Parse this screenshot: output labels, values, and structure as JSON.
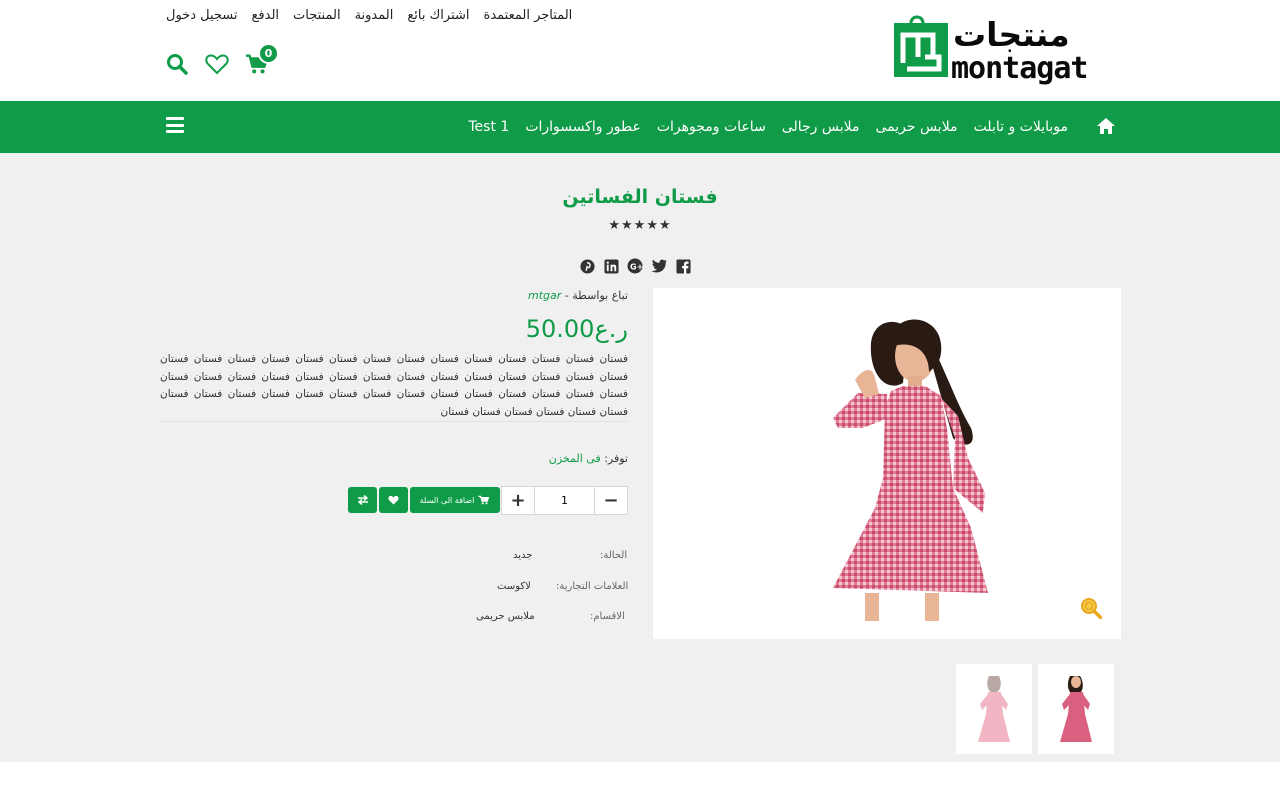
{
  "header": {
    "top_links": [
      "المتاجر المعتمدة",
      "اشتراك بائع",
      "المدونة",
      "المنتجات",
      "الدفع",
      "تسجيل دخول"
    ],
    "cart_count": "0",
    "logo": {
      "text_ar": "منتجات",
      "text_en": "montagat",
      "icon": "shopping-bag-logo"
    }
  },
  "nav": {
    "items": [
      "موبايلات و تابلت",
      "ملابس حريمى",
      "ملابس رجالى",
      "ساعات ومجوهرات",
      "عطور واكسسوارات",
      "Test 1"
    ]
  },
  "product": {
    "title": "فستان الفساتين",
    "stars": "★★★★★",
    "sold_by_label": "تباع بواسطة -",
    "vendor": "mtgar",
    "price": "50.00ر.ع",
    "description": "فستان فستان فستان فستان فستان فستان فستان فستان فستان فستان فستان فستان فستان فستان فستان فستان فستان فستان فستان فستان فستان فستان فستان فستان فستان فستان فستان فستان فستان فستان فستان فستان فستان فستان فستان فستان فستان فستان فستان فستان فستان فستان فستان فستان فستان فستان فستان فستان",
    "availability_label": "توفر:",
    "availability_value": "فى المخزن",
    "quantity": "1",
    "add_to_cart": "اضافة الى السلة",
    "condition_label": "الحالة:",
    "condition_value": "جديد",
    "brand_label": "العلامات التجارية:",
    "brand_value": "لاكوست",
    "category_label": "الاقسام:",
    "category_value": "ملابس حريمى"
  },
  "share_icons": [
    "facebook-icon",
    "twitter-icon",
    "google-plus-icon",
    "linkedin-icon",
    "pinterest-icon"
  ],
  "colors": {
    "brand_green": "#0f9b47",
    "dress_pink": "#d9607f"
  }
}
